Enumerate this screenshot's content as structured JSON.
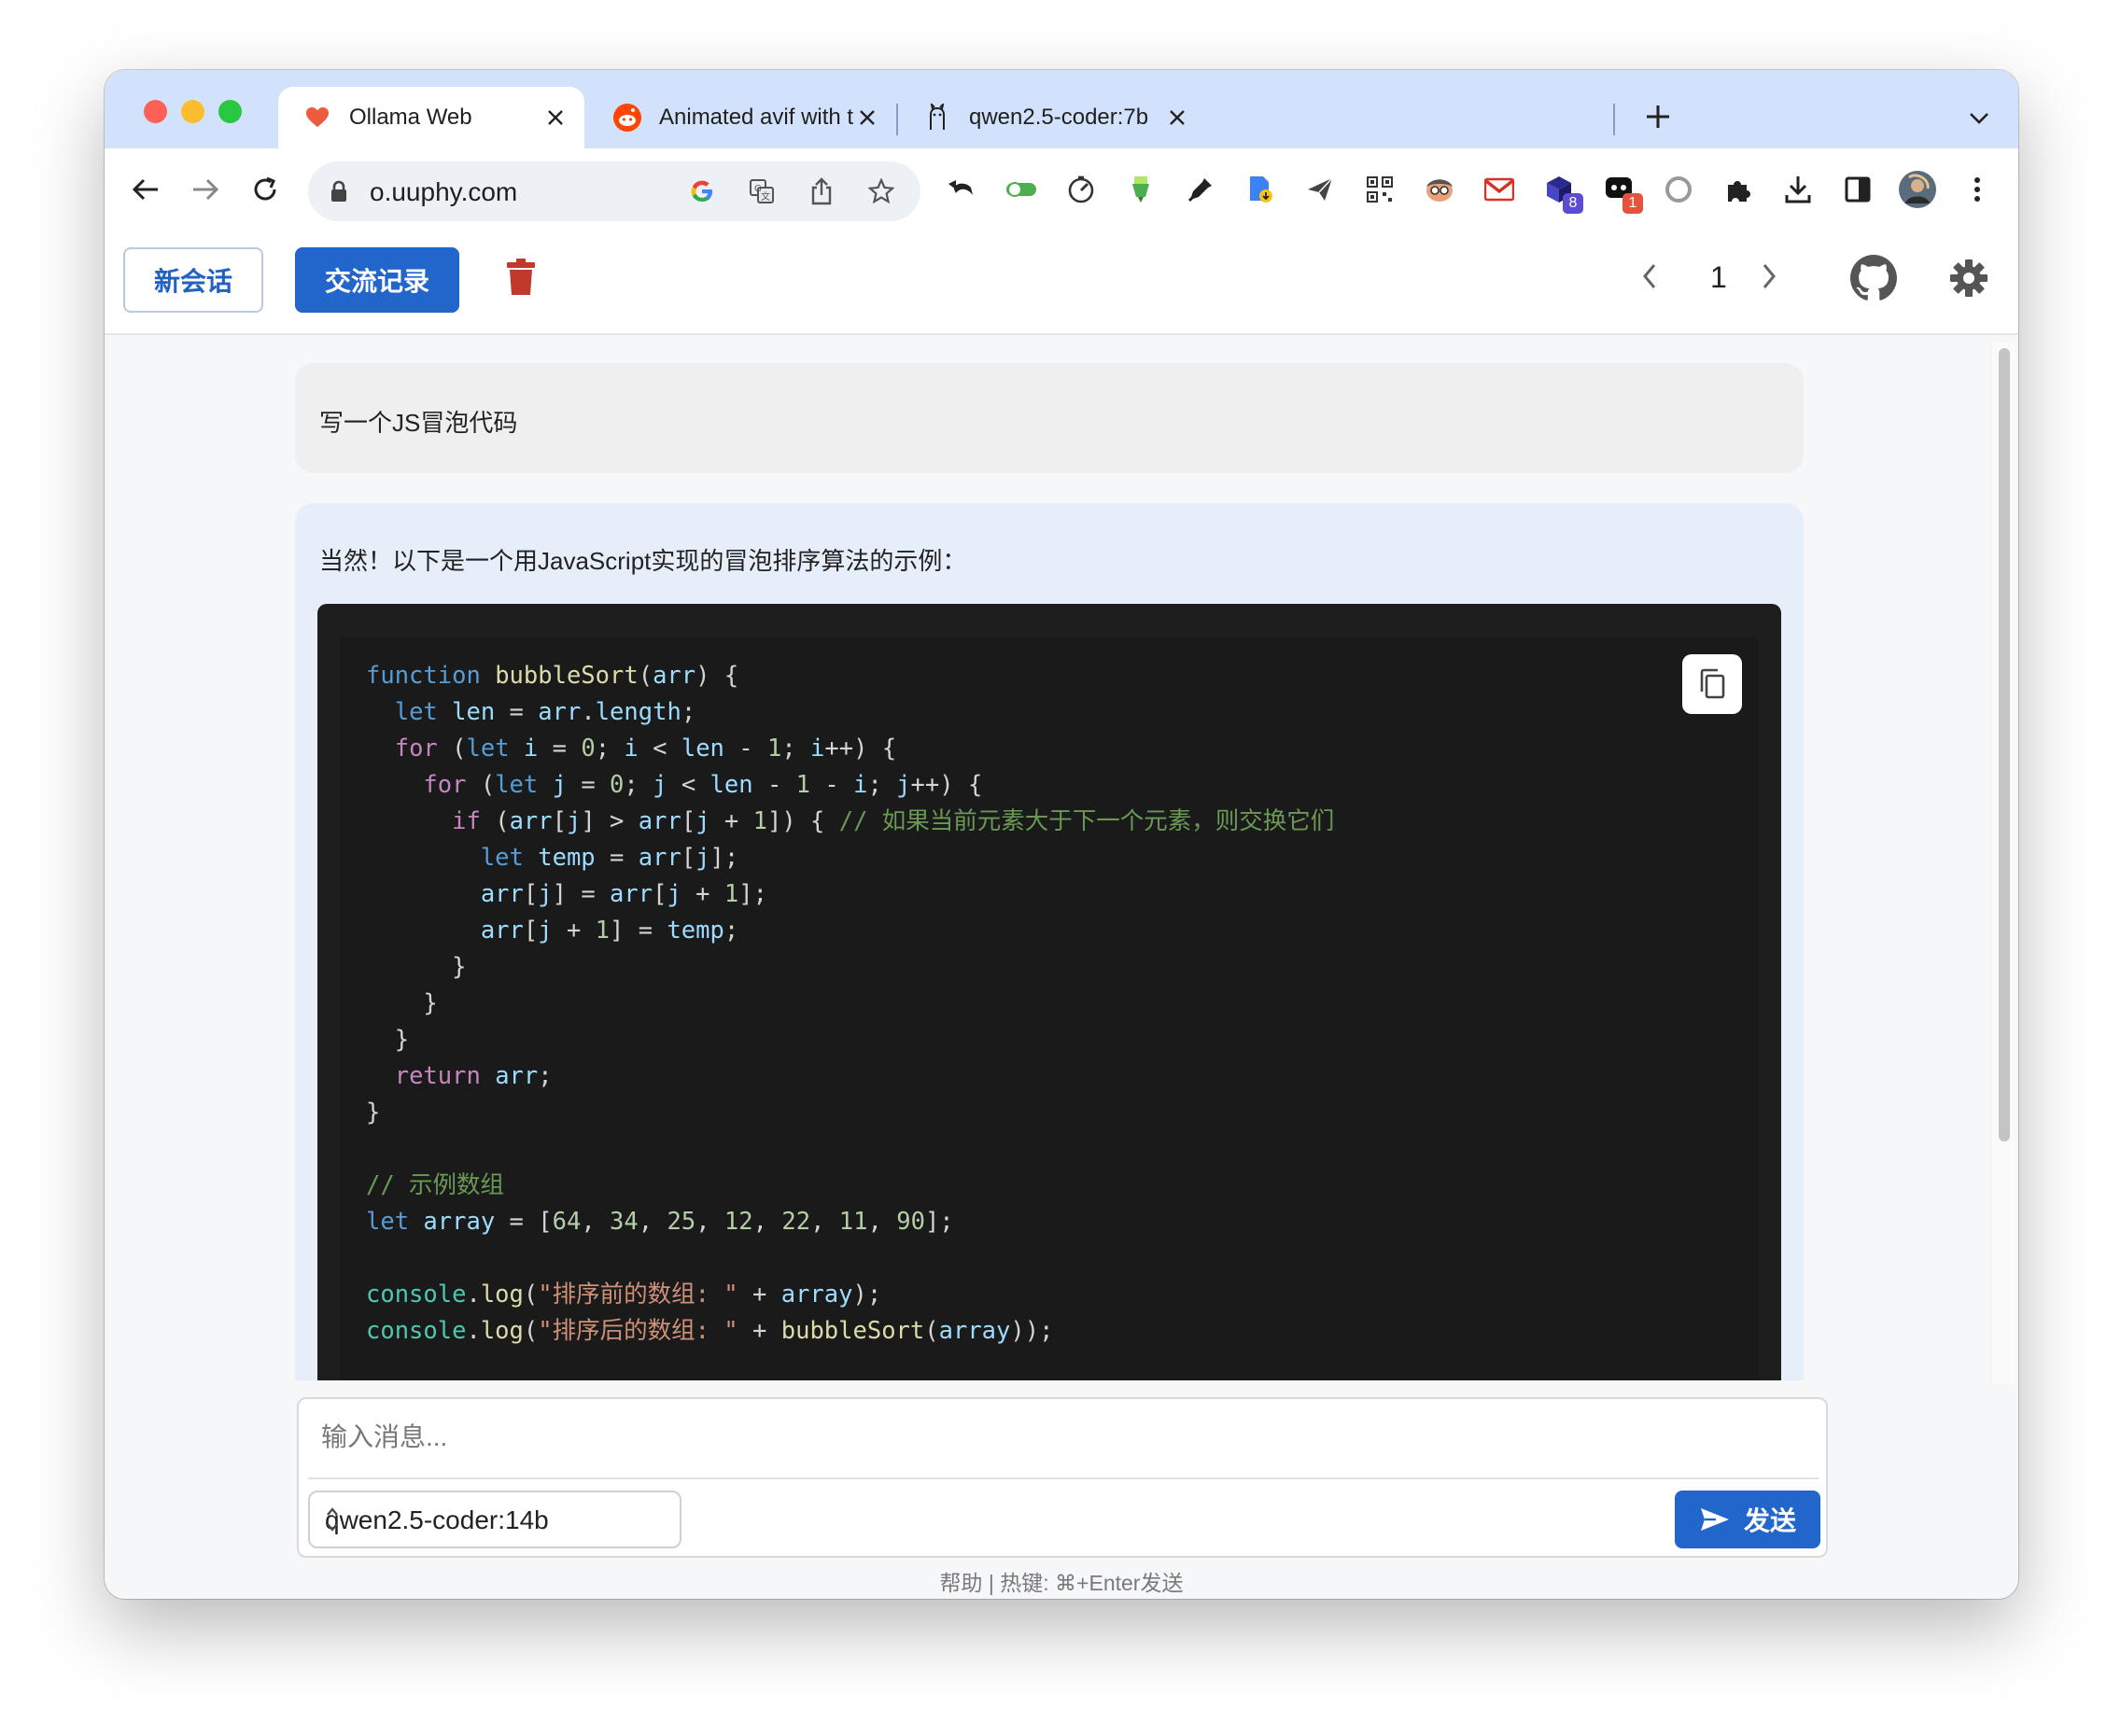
{
  "browser": {
    "tabs": [
      {
        "title": "Ollama Web",
        "active": true
      },
      {
        "title": "Animated avif with transparent",
        "active": false
      },
      {
        "title": "qwen2.5-coder:7b",
        "active": false
      }
    ],
    "url": "o.uuphy.com",
    "extension_badges": {
      "ext_a": "8",
      "ext_b": "1"
    }
  },
  "header": {
    "new_chat_label": "新会话",
    "history_label": "交流记录",
    "page_number": "1"
  },
  "chat": {
    "user_message": "写一个JS冒泡代码",
    "assistant_intro": "当然！以下是一个用JavaScript实现的冒泡排序算法的示例：",
    "code": {
      "lines": [
        [
          {
            "t": "kw",
            "v": "function"
          },
          {
            "t": "",
            "v": " "
          },
          {
            "t": "fn",
            "v": "bubbleSort"
          },
          {
            "t": "",
            "v": "("
          },
          {
            "t": "var",
            "v": "arr"
          },
          {
            "t": "",
            "v": ") {"
          }
        ],
        [
          {
            "t": "",
            "v": "  "
          },
          {
            "t": "kw",
            "v": "let"
          },
          {
            "t": "",
            "v": " "
          },
          {
            "t": "var",
            "v": "len"
          },
          {
            "t": "",
            "v": " = "
          },
          {
            "t": "var",
            "v": "arr"
          },
          {
            "t": "",
            "v": "."
          },
          {
            "t": "var",
            "v": "length"
          },
          {
            "t": "",
            "v": ";"
          }
        ],
        [
          {
            "t": "",
            "v": "  "
          },
          {
            "t": "ctl",
            "v": "for"
          },
          {
            "t": "",
            "v": " ("
          },
          {
            "t": "kw",
            "v": "let"
          },
          {
            "t": "",
            "v": " "
          },
          {
            "t": "var",
            "v": "i"
          },
          {
            "t": "",
            "v": " = "
          },
          {
            "t": "num",
            "v": "0"
          },
          {
            "t": "",
            "v": "; "
          },
          {
            "t": "var",
            "v": "i"
          },
          {
            "t": "",
            "v": " < "
          },
          {
            "t": "var",
            "v": "len"
          },
          {
            "t": "",
            "v": " - "
          },
          {
            "t": "num",
            "v": "1"
          },
          {
            "t": "",
            "v": "; "
          },
          {
            "t": "var",
            "v": "i"
          },
          {
            "t": "",
            "v": "++) {"
          }
        ],
        [
          {
            "t": "",
            "v": "    "
          },
          {
            "t": "ctl",
            "v": "for"
          },
          {
            "t": "",
            "v": " ("
          },
          {
            "t": "kw",
            "v": "let"
          },
          {
            "t": "",
            "v": " "
          },
          {
            "t": "var",
            "v": "j"
          },
          {
            "t": "",
            "v": " = "
          },
          {
            "t": "num",
            "v": "0"
          },
          {
            "t": "",
            "v": "; "
          },
          {
            "t": "var",
            "v": "j"
          },
          {
            "t": "",
            "v": " < "
          },
          {
            "t": "var",
            "v": "len"
          },
          {
            "t": "",
            "v": " - "
          },
          {
            "t": "num",
            "v": "1"
          },
          {
            "t": "",
            "v": " - "
          },
          {
            "t": "var",
            "v": "i"
          },
          {
            "t": "",
            "v": "; "
          },
          {
            "t": "var",
            "v": "j"
          },
          {
            "t": "",
            "v": "++) {"
          }
        ],
        [
          {
            "t": "",
            "v": "      "
          },
          {
            "t": "ctl",
            "v": "if"
          },
          {
            "t": "",
            "v": " ("
          },
          {
            "t": "var",
            "v": "arr"
          },
          {
            "t": "",
            "v": "["
          },
          {
            "t": "var",
            "v": "j"
          },
          {
            "t": "",
            "v": "] > "
          },
          {
            "t": "var",
            "v": "arr"
          },
          {
            "t": "",
            "v": "["
          },
          {
            "t": "var",
            "v": "j"
          },
          {
            "t": "",
            "v": " + "
          },
          {
            "t": "num",
            "v": "1"
          },
          {
            "t": "",
            "v": "]) { "
          },
          {
            "t": "cm",
            "v": "// 如果当前元素大于下一个元素，则交换它们"
          }
        ],
        [
          {
            "t": "",
            "v": "        "
          },
          {
            "t": "kw",
            "v": "let"
          },
          {
            "t": "",
            "v": " "
          },
          {
            "t": "var",
            "v": "temp"
          },
          {
            "t": "",
            "v": " = "
          },
          {
            "t": "var",
            "v": "arr"
          },
          {
            "t": "",
            "v": "["
          },
          {
            "t": "var",
            "v": "j"
          },
          {
            "t": "",
            "v": "];"
          }
        ],
        [
          {
            "t": "",
            "v": "        "
          },
          {
            "t": "var",
            "v": "arr"
          },
          {
            "t": "",
            "v": "["
          },
          {
            "t": "var",
            "v": "j"
          },
          {
            "t": "",
            "v": "] = "
          },
          {
            "t": "var",
            "v": "arr"
          },
          {
            "t": "",
            "v": "["
          },
          {
            "t": "var",
            "v": "j"
          },
          {
            "t": "",
            "v": " + "
          },
          {
            "t": "num",
            "v": "1"
          },
          {
            "t": "",
            "v": "];"
          }
        ],
        [
          {
            "t": "",
            "v": "        "
          },
          {
            "t": "var",
            "v": "arr"
          },
          {
            "t": "",
            "v": "["
          },
          {
            "t": "var",
            "v": "j"
          },
          {
            "t": "",
            "v": " + "
          },
          {
            "t": "num",
            "v": "1"
          },
          {
            "t": "",
            "v": "] = "
          },
          {
            "t": "var",
            "v": "temp"
          },
          {
            "t": "",
            "v": ";"
          }
        ],
        [
          {
            "t": "",
            "v": "      }"
          }
        ],
        [
          {
            "t": "",
            "v": "    }"
          }
        ],
        [
          {
            "t": "",
            "v": "  }"
          }
        ],
        [
          {
            "t": "",
            "v": "  "
          },
          {
            "t": "ctl",
            "v": "return"
          },
          {
            "t": "",
            "v": " "
          },
          {
            "t": "var",
            "v": "arr"
          },
          {
            "t": "",
            "v": ";"
          }
        ],
        [
          {
            "t": "",
            "v": "}"
          }
        ],
        [
          {
            "t": "",
            "v": ""
          }
        ],
        [
          {
            "t": "cm",
            "v": "// 示例数组"
          }
        ],
        [
          {
            "t": "kw",
            "v": "let"
          },
          {
            "t": "",
            "v": " "
          },
          {
            "t": "var",
            "v": "array"
          },
          {
            "t": "",
            "v": " = ["
          },
          {
            "t": "num",
            "v": "64"
          },
          {
            "t": "",
            "v": ", "
          },
          {
            "t": "num",
            "v": "34"
          },
          {
            "t": "",
            "v": ", "
          },
          {
            "t": "num",
            "v": "25"
          },
          {
            "t": "",
            "v": ", "
          },
          {
            "t": "num",
            "v": "12"
          },
          {
            "t": "",
            "v": ", "
          },
          {
            "t": "num",
            "v": "22"
          },
          {
            "t": "",
            "v": ", "
          },
          {
            "t": "num",
            "v": "11"
          },
          {
            "t": "",
            "v": ", "
          },
          {
            "t": "num",
            "v": "90"
          },
          {
            "t": "",
            "v": "];"
          }
        ],
        [
          {
            "t": "",
            "v": ""
          }
        ],
        [
          {
            "t": "obj",
            "v": "console"
          },
          {
            "t": "",
            "v": "."
          },
          {
            "t": "fn",
            "v": "log"
          },
          {
            "t": "",
            "v": "("
          },
          {
            "t": "str",
            "v": "\"排序前的数组: \""
          },
          {
            "t": "",
            "v": " + "
          },
          {
            "t": "var",
            "v": "array"
          },
          {
            "t": "",
            "v": ");"
          }
        ],
        [
          {
            "t": "obj",
            "v": "console"
          },
          {
            "t": "",
            "v": "."
          },
          {
            "t": "fn",
            "v": "log"
          },
          {
            "t": "",
            "v": "("
          },
          {
            "t": "str",
            "v": "\"排序后的数组: \""
          },
          {
            "t": "",
            "v": " + "
          },
          {
            "t": "fn",
            "v": "bubbleSort"
          },
          {
            "t": "",
            "v": "("
          },
          {
            "t": "var",
            "v": "array"
          },
          {
            "t": "",
            "v": "));"
          }
        ]
      ]
    }
  },
  "composer": {
    "placeholder": "输入消息...",
    "value": "",
    "model": "qwen2.5-coder:14b",
    "send_label": "发送"
  },
  "footer": {
    "text": "帮助 | 热键: ⌘+Enter发送"
  },
  "colors": {
    "accent": "#2266cc",
    "tabstrip": "#d3e2fc",
    "code_bg": "#1e1e1e",
    "trash": "#c0392b"
  },
  "icons": [
    "heart-icon",
    "reddit-icon",
    "llama-icon",
    "close-icon",
    "plus-icon",
    "chevron-down-icon",
    "back-icon",
    "forward-icon",
    "reload-icon",
    "lock-icon",
    "google-icon",
    "translate-icon",
    "share-icon",
    "star-icon",
    "trash-icon",
    "chevron-left-icon",
    "chevron-right-icon",
    "github-icon",
    "gear-icon",
    "copy-icon",
    "send-icon",
    "updown-icon"
  ]
}
